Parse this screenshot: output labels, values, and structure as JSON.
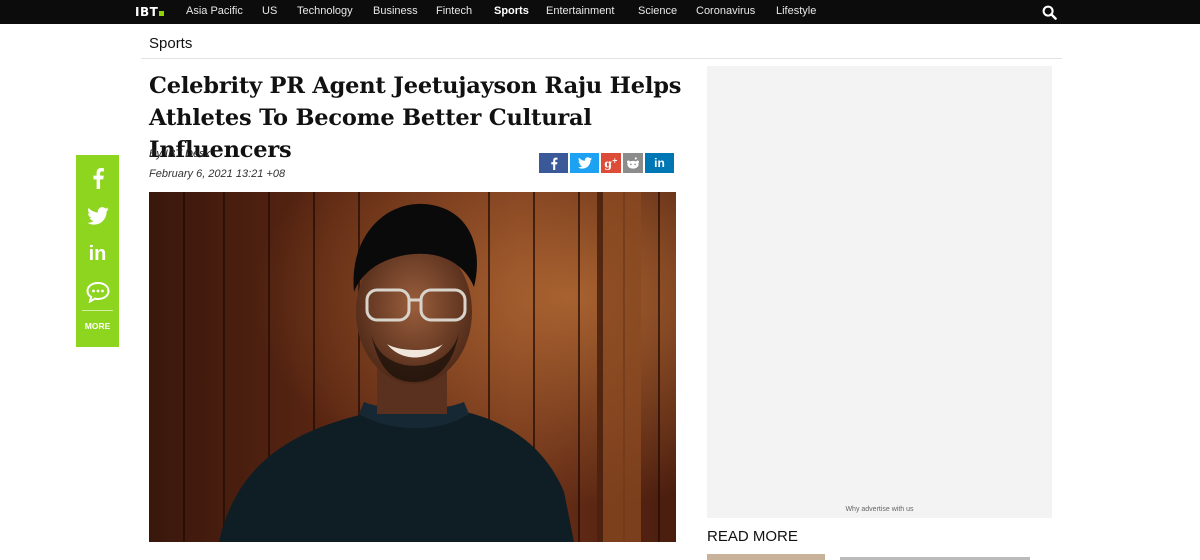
{
  "nav": {
    "logo": "IBT",
    "links": [
      {
        "label": "Asia Pacific"
      },
      {
        "label": "US"
      },
      {
        "label": "Technology"
      },
      {
        "label": "Business"
      },
      {
        "label": "Fintech"
      },
      {
        "label": "Sports",
        "active": true
      },
      {
        "label": "Entertainment"
      },
      {
        "label": "Science"
      },
      {
        "label": "Coronavirus"
      },
      {
        "label": "Lifestyle"
      }
    ],
    "search_icon": "search-icon"
  },
  "section": {
    "title": "Sports"
  },
  "article": {
    "headline": "Celebrity PR Agent Jeetujayson Raju Helps Athletes To Become Better Cultural Influencers",
    "byline": "By IBT Desk",
    "date": "February 6, 2021 13:21 +08",
    "share_buttons": [
      {
        "icon": "facebook-icon",
        "glyph": "f"
      },
      {
        "icon": "twitter-icon",
        "glyph": "🐦"
      },
      {
        "icon": "google-plus-icon",
        "glyph": "g+"
      },
      {
        "icon": "reddit-icon",
        "glyph": "◉"
      },
      {
        "icon": "linkedin-icon",
        "glyph": "in"
      }
    ]
  },
  "floating_share": {
    "items": [
      "facebook-icon",
      "twitter-icon",
      "linkedin-icon",
      "comment-icon"
    ],
    "more_label": "MORE"
  },
  "ad": {
    "note": "Why advertise with us"
  },
  "sidebar": {
    "read_more": "READ MORE"
  },
  "colors": {
    "nav_bg": "#0c0c0c",
    "accent_green": "#8ed51f",
    "facebook": "#3b5998",
    "twitter": "#1da1f2",
    "google_plus": "#dd4b39",
    "reddit": "#8c8c8c",
    "linkedin": "#0077b5"
  }
}
